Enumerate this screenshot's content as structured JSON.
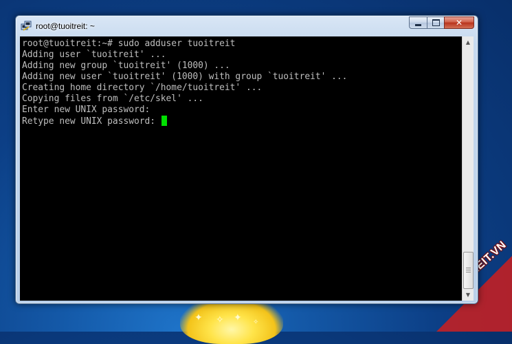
{
  "window": {
    "title": "root@tuoitreit: ~",
    "icon": "putty-icon",
    "controls": {
      "minimize": "minimize-icon",
      "maximize": "maximize-icon",
      "close": "✕"
    }
  },
  "terminal": {
    "lines": [
      "root@tuoitreit:~# sudo adduser tuoitreit",
      "Adding user `tuoitreit' ...",
      "Adding new group `tuoitreit' (1000) ...",
      "Adding new user `tuoitreit' (1000) with group `tuoitreit' ...",
      "Creating home directory `/home/tuoitreit' ...",
      "Copying files from `/etc/skel' ...",
      "Enter new UNIX password:",
      "Retype new UNIX password: "
    ],
    "text_color": "#bfbfbf",
    "cursor_color": "#00e000",
    "background": "#000000"
  },
  "scrollbar": {
    "up": "▲",
    "down": "▼"
  },
  "watermark": {
    "text": "TUOITREIT.VN",
    "color": "#cd1e1e"
  }
}
